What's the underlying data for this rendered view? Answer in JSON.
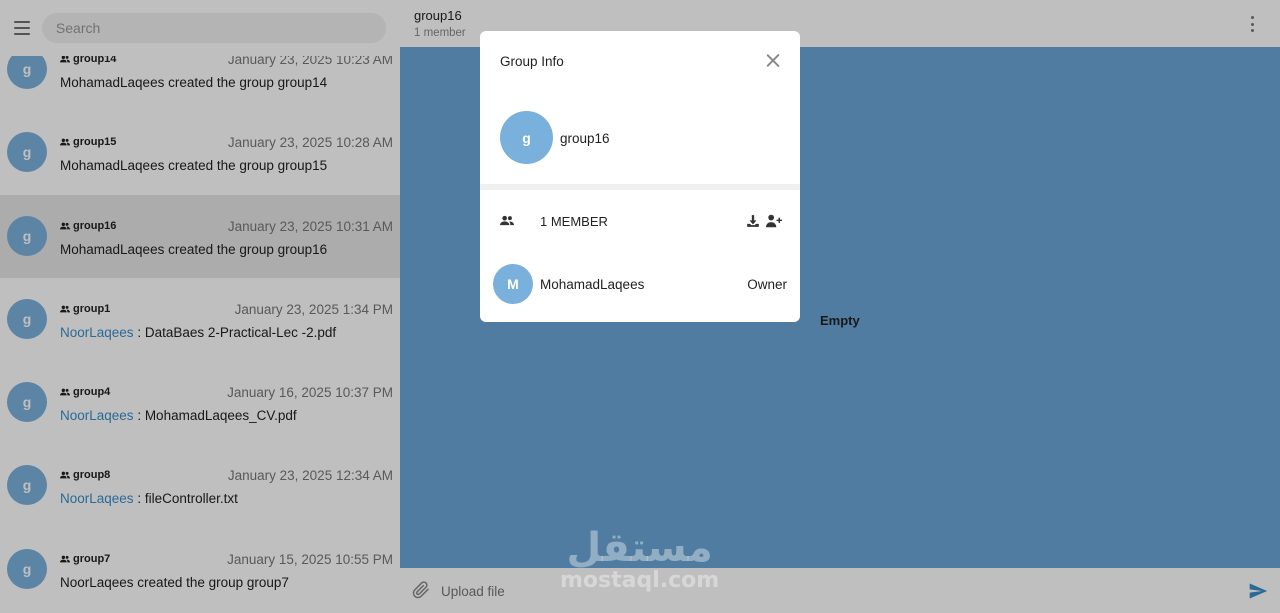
{
  "search": {
    "placeholder": "Search"
  },
  "chats": [
    {
      "avatar": "g",
      "name": "group14",
      "time": "January 23, 2025 10:23 AM",
      "sender": "",
      "message": "MohamadLaqees created the group group14",
      "active": false
    },
    {
      "avatar": "g",
      "name": "group15",
      "time": "January 23, 2025 10:28 AM",
      "sender": "",
      "message": "MohamadLaqees created the group group15",
      "active": false
    },
    {
      "avatar": "g",
      "name": "group16",
      "time": "January 23, 2025 10:31 AM",
      "sender": "",
      "message": "MohamadLaqees created the group group16",
      "active": true
    },
    {
      "avatar": "g",
      "name": "group1",
      "time": "January 23, 2025 1:34 PM",
      "sender": "NoorLaqees",
      "message": " : DataBaes 2-Practical-Lec -2.pdf",
      "active": false
    },
    {
      "avatar": "g",
      "name": "group4",
      "time": "January 16, 2025 10:37 PM",
      "sender": "NoorLaqees",
      "message": " : MohamadLaqees_CV.pdf",
      "active": false
    },
    {
      "avatar": "g",
      "name": "group8",
      "time": "January 23, 2025 12:34 AM",
      "sender": "NoorLaqees",
      "message": " : fileController.txt",
      "active": false
    },
    {
      "avatar": "g",
      "name": "group7",
      "time": "January 15, 2025 10:55 PM",
      "sender": "",
      "message": "NoorLaqees created the group group7",
      "active": false
    }
  ],
  "header": {
    "title": "group16",
    "subtitle": "1 member"
  },
  "body": {
    "empty_label": "Empty"
  },
  "footer": {
    "upload_label": "Upload file"
  },
  "watermark": {
    "arabic": "مستقل",
    "latin": "mostaql.com"
  },
  "modal": {
    "title": "Group Info",
    "group_avatar": "g",
    "group_name": "group16",
    "members_count": "1 MEMBER",
    "members": [
      {
        "avatar": "M",
        "name": "MohamadLaqees",
        "role": "Owner"
      }
    ]
  },
  "colors": {
    "accent": "#3a8dc9",
    "avatar": "#7ab0dc",
    "chat_background": "#6aa6d6"
  }
}
